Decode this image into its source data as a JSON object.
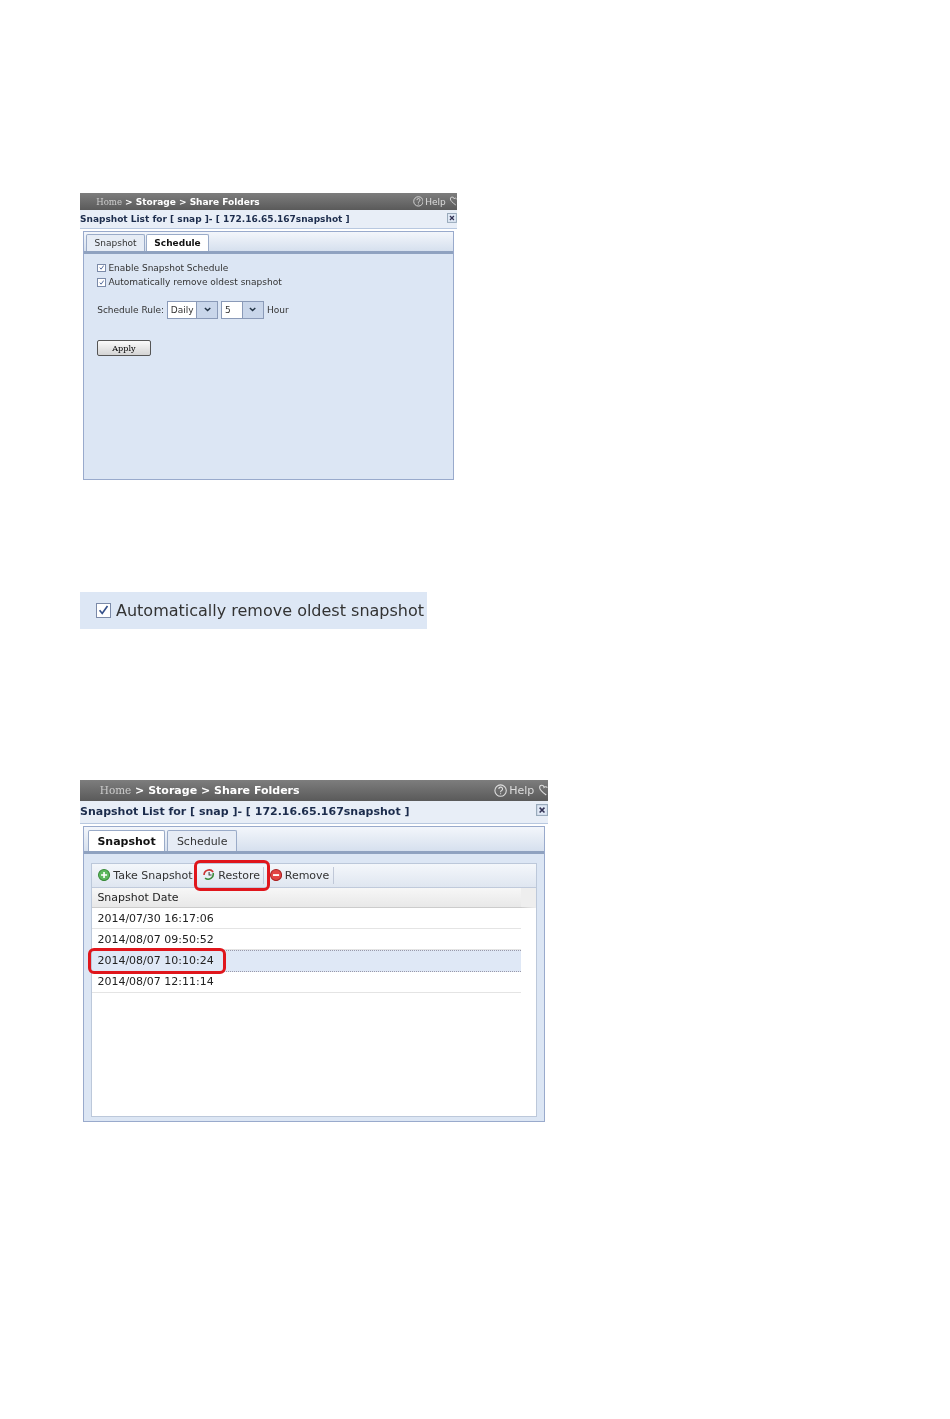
{
  "figures": [
    {
      "kind": "schedule",
      "breadcrumb": [
        {
          "label": "Home"
        },
        {
          "label": "Storage"
        },
        {
          "label": "Share Folders"
        }
      ],
      "separator": ">",
      "help": "Help",
      "title": "Snapshot List for [ snap ]- [ 172.16.65.167snapshot ]",
      "tabs": [
        {
          "label": "Snapshot",
          "selected": false
        },
        {
          "label": "Schedule",
          "selected": true
        }
      ],
      "options": [
        {
          "label": "Enable Snapshot Schedule",
          "checked": true
        },
        {
          "label": "Automatically remove oldest snapshot",
          "checked": true
        }
      ],
      "rule_label": "Schedule Rule:",
      "selects": [
        {
          "value": "Daily"
        },
        {
          "value": "5"
        }
      ],
      "unit": "Hour",
      "apply": "Apply"
    },
    {
      "kind": "checkbox_strip",
      "label": "Automatically remove oldest snapshot",
      "checked": true
    },
    {
      "kind": "list",
      "breadcrumb": [
        {
          "label": "Home"
        },
        {
          "label": "Storage"
        },
        {
          "label": "Share Folders"
        }
      ],
      "separator": ">",
      "help": "Help",
      "title": "Snapshot List for [ snap ]- [ 172.16.65.167snapshot ]",
      "tabs": [
        {
          "label": "Snapshot",
          "selected": true
        },
        {
          "label": "Schedule",
          "selected": false
        }
      ],
      "toolbar": [
        {
          "label": "Take Snapshot",
          "kind": "add",
          "highlighted": false
        },
        {
          "label": "Restore",
          "kind": "restore",
          "highlighted": true
        },
        {
          "label": "Remove",
          "kind": "remove",
          "highlighted": false
        }
      ],
      "column": "Snapshot Date",
      "rows": [
        {
          "date": "2014/07/30 16:17:06",
          "selected": false,
          "highlighted": false
        },
        {
          "date": "2014/08/07 09:50:52",
          "selected": false,
          "highlighted": false
        },
        {
          "date": "2014/08/07 10:10:24",
          "selected": true,
          "highlighted": true
        },
        {
          "date": "2014/08/07 12:11:14",
          "selected": false,
          "highlighted": false
        }
      ]
    }
  ]
}
